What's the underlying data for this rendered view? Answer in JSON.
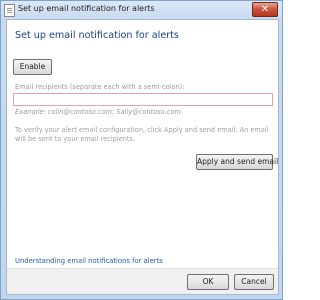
{
  "window": {
    "title": "Set up email notification for alerts",
    "close_glyph": "✕"
  },
  "dialog": {
    "heading": "Set up email notification for alerts",
    "enable_label": "Enable",
    "recipients_label": "Email recipients (separate each with a semi-colon):",
    "recipients_value": "",
    "example": "Example: colin@contoso.com; Sally@contoso.com",
    "verify_text": "To verify your alert email configuration, click Apply and send email. An email will be sent to your email recipients.",
    "apply_label": "Apply and send email",
    "help_link": "Understanding email notifications for alerts"
  },
  "footer": {
    "ok_label": "OK",
    "cancel_label": "Cancel"
  }
}
